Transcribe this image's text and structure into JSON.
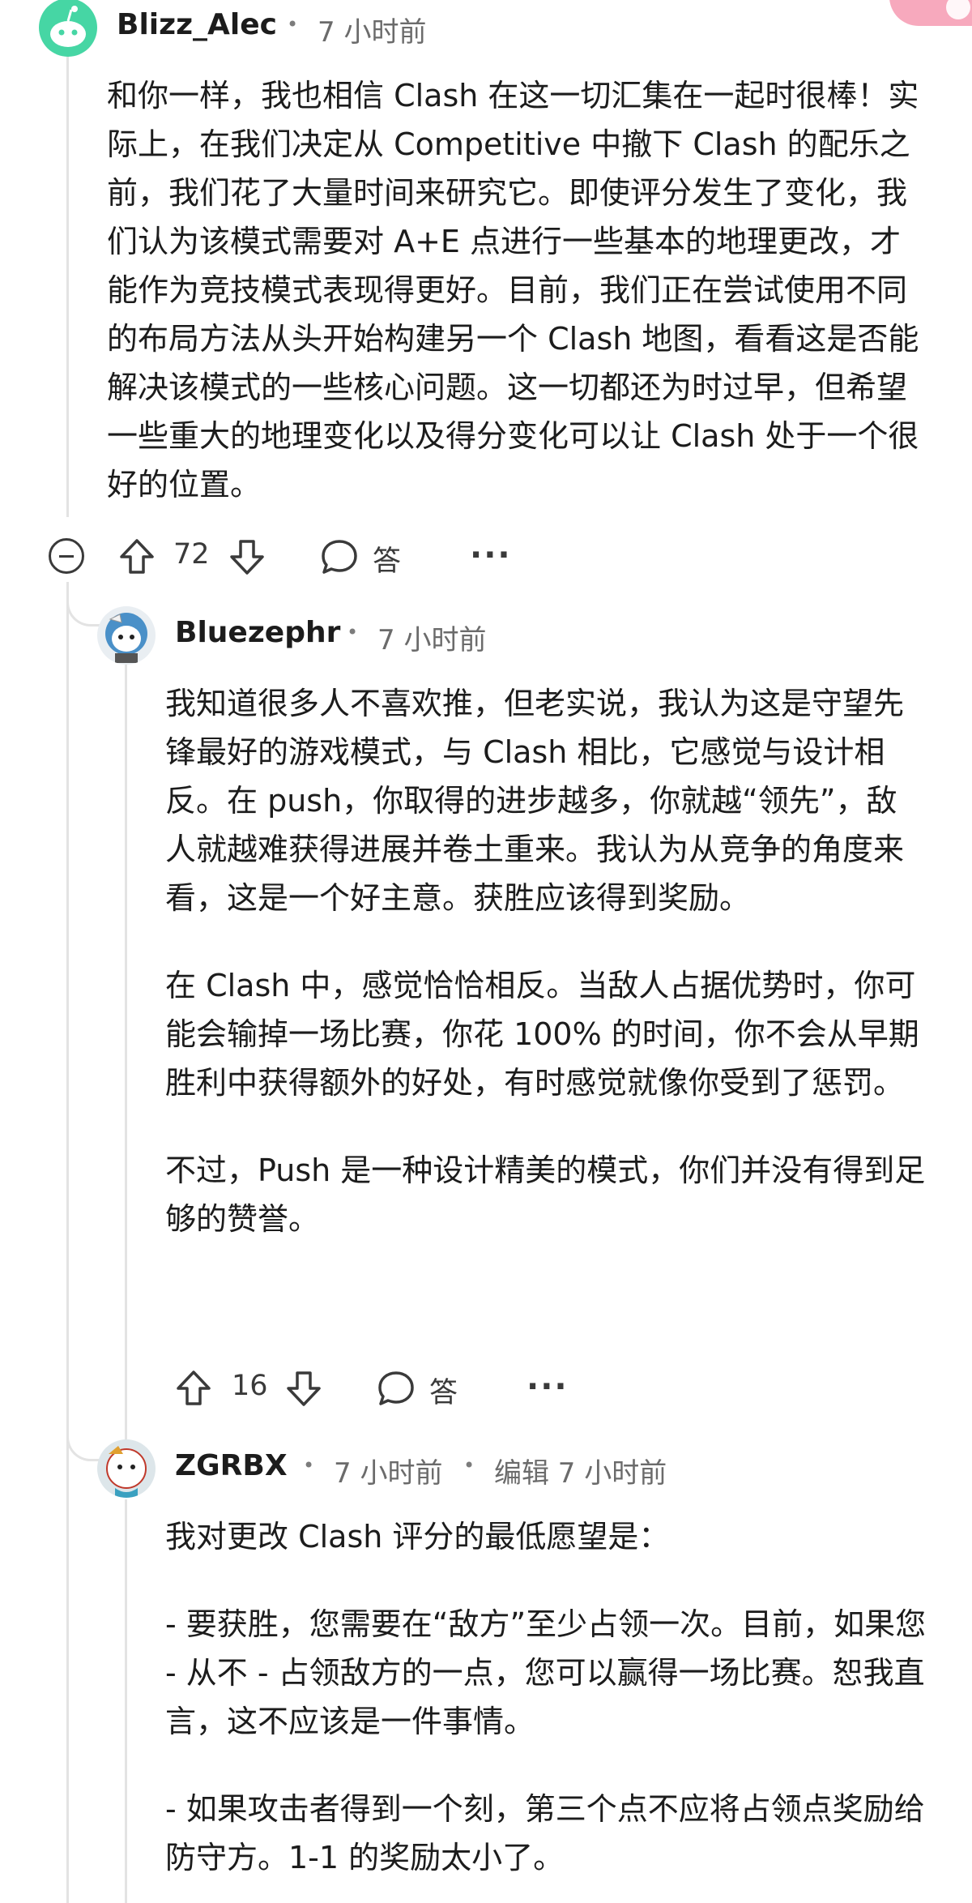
{
  "comments": [
    {
      "username": "Blizz_Alec",
      "time": "7 小时前",
      "paragraphs": [
        "和你一样，我也相信 Clash 在这一切汇集在一起时很棒！实际上，在我们决定从 Competitive 中撤下 Clash 的配乐之前，我们花了大量时间来研究它。即使评分发生了变化，我们认为该模式需要对 A+E 点进行一些基本的地理更改，才能作为竞技模式表现得更好。目前，我们正在尝试使用不同的布局方法从头开始构建另一个 Clash 地图，看看这是否能解决该模式的一些核心问题。这一切都还为时过早，但希望一些重大的地理变化以及得分变化可以让 Clash 处于一个很好的位置。"
      ],
      "upvotes": "72",
      "reply_label": "答",
      "more": "···"
    },
    {
      "username": "Bluezephr",
      "time": "7 小时前",
      "paragraphs": [
        "我知道很多人不喜欢推，但老实说，我认为这是守望先锋最好的游戏模式，与 Clash 相比，它感觉与设计相反。在 push，你取得的进步越多，你就越“领先”，敌人就越难获得进展并卷土重来。我认为从竞争的角度来看，这是一个好主意。获胜应该得到奖励。",
        "在 Clash 中，感觉恰恰相反。当敌人占据优势时，你可能会输掉一场比赛，你花 100% 的时间，你不会从早期胜利中获得额外的好处，有时感觉就像你受到了惩罚。",
        "不过，Push 是一种设计精美的模式，你们并没有得到足够的赞誉。"
      ],
      "upvotes": "16",
      "reply_label": "答",
      "more": "···"
    },
    {
      "username": "ZGRBX",
      "time": "7 小时前",
      "edited": "编辑 7 小时前",
      "paragraphs": [
        "我对更改 Clash 评分的最低愿望是：",
        "- 要获胜，您需要在“敌方”至少占领一次。目前，如果您 - 从不 - 占领敌方的一点，您可以赢得一场比赛。恕我直言，这不应该是一件事情。",
        "- 如果攻击者得到一个刻，第三个点不应将占领点奖励给防守方。1-1 的奖励太小了。"
      ]
    }
  ],
  "colors": {
    "avatar1": "#46d6a4",
    "avatar2": "#e9eef2",
    "avatar3": "#dde6ea",
    "corner_badge": "#f7a9bd"
  }
}
